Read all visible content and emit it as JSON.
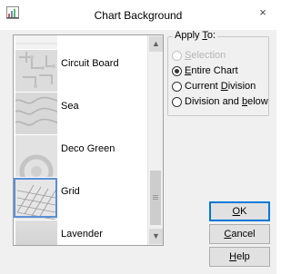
{
  "dialog": {
    "title": "Chart Background",
    "close_glyph": "×",
    "app_icon": "chart-app-icon"
  },
  "list": {
    "items": [
      {
        "label": "",
        "pattern": "white-tile"
      },
      {
        "label": "Circuit Board",
        "pattern": "circuit-board"
      },
      {
        "label": "Sea",
        "pattern": "sea-waves"
      },
      {
        "label": "Deco Green",
        "pattern": "deco-green"
      },
      {
        "label": "Grid",
        "pattern": "grid",
        "selected": true
      },
      {
        "label": "Lavender",
        "pattern": "lavender"
      }
    ],
    "scroll_up_glyph": "▲",
    "scroll_down_glyph": "▼"
  },
  "apply_to": {
    "legend_pre": "Apply ",
    "legend_ul": "T",
    "legend_post": "o:",
    "options": [
      {
        "pre": "",
        "ul": "S",
        "post": "election",
        "checked": false,
        "disabled": true
      },
      {
        "pre": "",
        "ul": "E",
        "post": "ntire Chart",
        "checked": true,
        "disabled": false
      },
      {
        "pre": "Current ",
        "ul": "D",
        "post": "ivision",
        "checked": false,
        "disabled": false
      },
      {
        "pre": "Division and ",
        "ul": "b",
        "post": "elow",
        "checked": false,
        "disabled": false
      }
    ]
  },
  "buttons": {
    "ok": {
      "pre": "",
      "ul": "O",
      "post": "K"
    },
    "cancel": {
      "pre": "",
      "ul": "C",
      "post": "ancel"
    },
    "help": {
      "pre": "",
      "ul": "H",
      "post": "elp"
    }
  },
  "colors": {
    "selection_border": "#5b8ed6",
    "default_button_border": "#0078d7",
    "dialog_bg": "#f0f0f0"
  }
}
